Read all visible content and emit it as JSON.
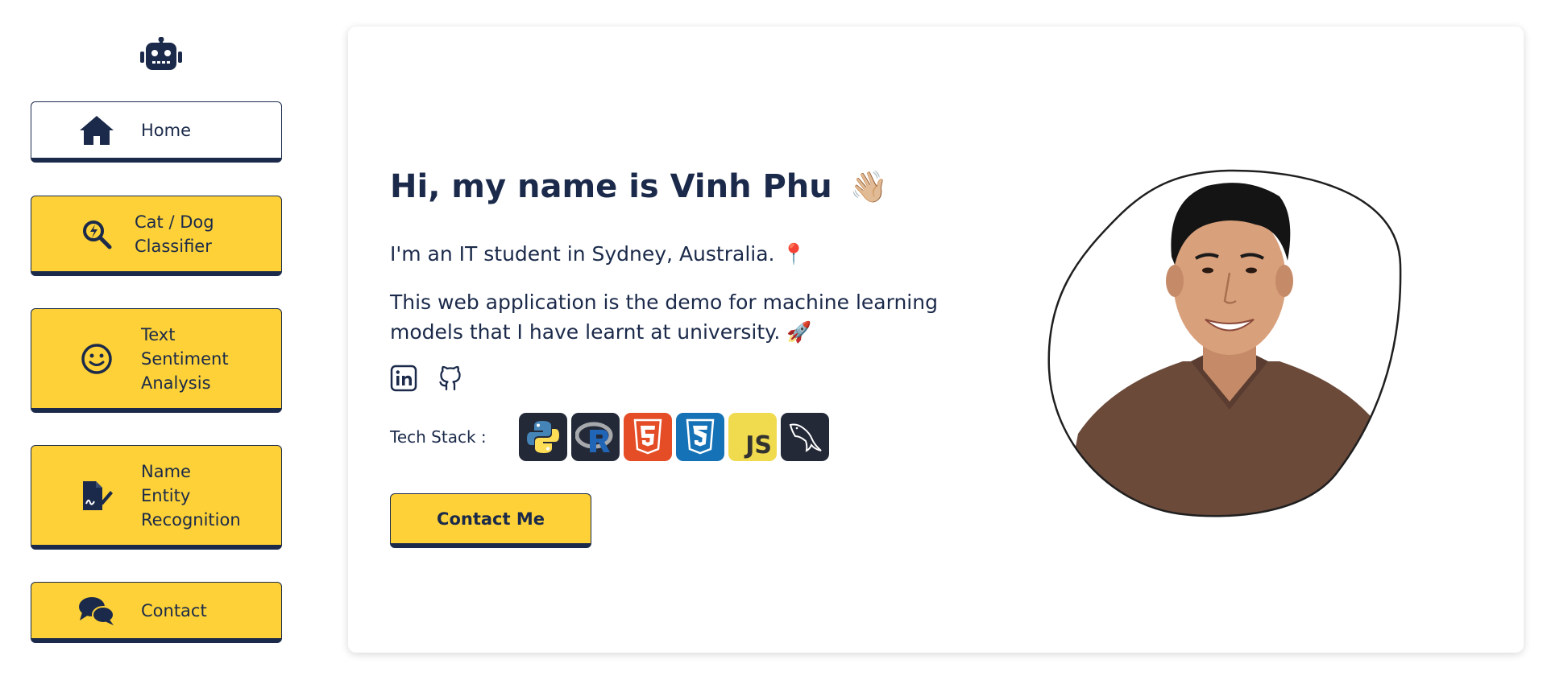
{
  "sidebar": {
    "logo_icon": "robot-icon",
    "items": [
      {
        "label": "Home",
        "icon": "home-icon",
        "active": true
      },
      {
        "label": "Cat / Dog\nClassifier",
        "icon": "search-lightning-icon",
        "active": false
      },
      {
        "label": "Text\nSentiment\nAnalysis",
        "icon": "smile-icon",
        "active": false
      },
      {
        "label": "Name\nEntity\nRecognition",
        "icon": "document-signature-icon",
        "active": false
      },
      {
        "label": "Contact",
        "icon": "chat-bubbles-icon",
        "active": false
      }
    ]
  },
  "main": {
    "greeting_prefix": "Hi, my name is ",
    "name": "Vinh Phu",
    "wave_emoji": "👋🏼",
    "intro_text": "I'm an IT student in Sydney, Australia.",
    "pin_emoji": "📍",
    "description": "This web application is the demo for machine learning models that I have learnt at university.",
    "rocket_emoji": "🚀",
    "social": [
      {
        "icon": "linkedin-icon"
      },
      {
        "icon": "github-icon"
      }
    ],
    "tech_stack_label": "Tech Stack :",
    "tech_stack": [
      {
        "icon": "python-icon",
        "color": "#242938"
      },
      {
        "icon": "r-icon",
        "color": "#242938"
      },
      {
        "icon": "html5-icon",
        "color": "#e44d26"
      },
      {
        "icon": "css3-icon",
        "color": "#1572b6"
      },
      {
        "icon": "javascript-icon",
        "label": "JS",
        "color": "#f0db4f"
      },
      {
        "icon": "mysql-icon",
        "color": "#242938"
      }
    ],
    "contact_button_label": "Contact Me"
  },
  "colors": {
    "navy": "#1b2a4a",
    "accent_yellow": "#fdd137",
    "background": "#ffffff"
  }
}
